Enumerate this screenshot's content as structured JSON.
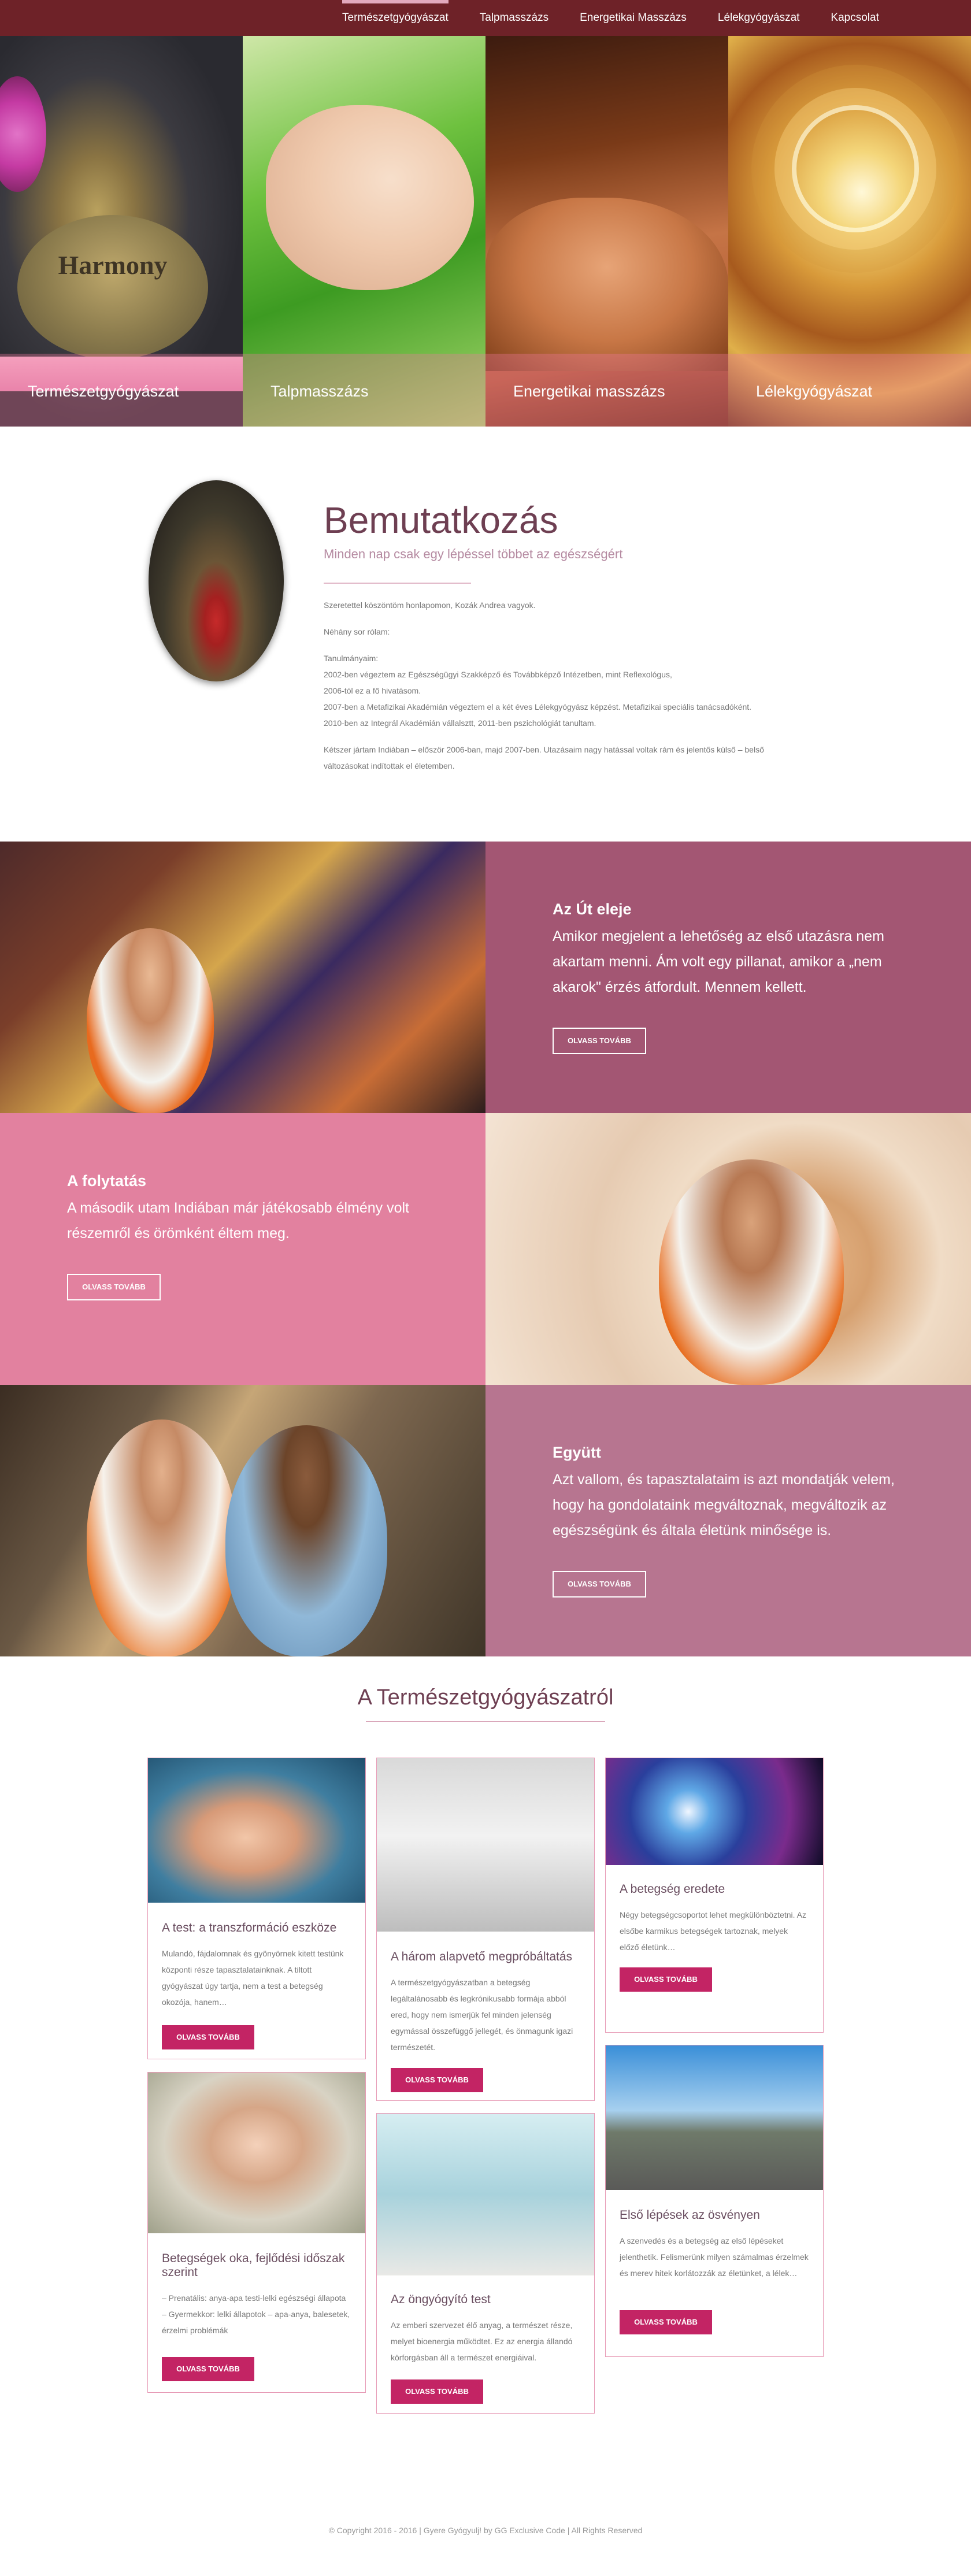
{
  "nav": {
    "items": [
      {
        "label": "Természetgyógyászat",
        "active": true
      },
      {
        "label": "Talpmasszázs",
        "active": false
      },
      {
        "label": "Energetikai Masszázs",
        "active": false
      },
      {
        "label": "Lélekgyógyászat",
        "active": false
      },
      {
        "label": "Kapcsolat",
        "active": false
      }
    ]
  },
  "hero": {
    "tiles": [
      {
        "label": "Természetgyógyászat",
        "stone_text": "Harmony"
      },
      {
        "label": "Talpmasszázs"
      },
      {
        "label": "Energetikai masszázs"
      },
      {
        "label": "Lélekgyógyászat"
      }
    ]
  },
  "intro": {
    "title": "Bemutatkozás",
    "subtitle": "Minden nap csak egy lépéssel többet az egészségért",
    "paragraphs": [
      "Szeretettel köszöntöm honlapomon, Kozák Andrea vagyok.",
      "Néhány sor rólam:"
    ],
    "studies_heading": "Tanulmányaim:",
    "studies": [
      "2002-ben végeztem az Egészségügyi Szakképző és Továbbképző Intézetben, mint Reflexológus,",
      "2006-tól ez a fő hivatásom.",
      "2007-ben a Metafizikai Akadémián végeztem el a két éves Lélekgyógyász képzést. Metafizikai speciális tanácsadóként.",
      "2010-ben az Integrál Akadémián vállalsztt, 2011-ben pszichológiát tanultam."
    ],
    "closing": "Kétszer jártam Indiában – először 2006-ban, majd 2007-ben. Utazásaim nagy hatással voltak rám és jelentős külső – belső változásokat indítottak el életemben."
  },
  "bands": [
    {
      "title": "Az Út eleje",
      "text": "Amikor megjelent a lehetőség az első utazásra nem akartam menni. Ám volt egy pillanat, amikor a „nem akarok\" érzés átfordult. Mennem kellett.",
      "button": "OLVASS TOVÁBB"
    },
    {
      "title": "A folytatás",
      "text": "A második utam Indiában már játékosabb élmény volt részemről és örömként éltem meg.",
      "button": "OLVASS TOVÁBB"
    },
    {
      "title": "Együtt",
      "text": "Azt vallom, és tapasztalataim is azt mondatják velem, hogy ha gondolataink megváltoznak, megváltozik az egészségünk és általa életünk minősége is.",
      "button": "OLVASS TOVÁBB"
    }
  ],
  "blog": {
    "heading": "A Természetgyógyászatról",
    "cards": [
      {
        "title": "A test: a transzformáció eszköze",
        "text": "Mulandó, fájdalomnak és gyönyörnek kitett testünk központi része tapasztalatainknak. A tiltott gyógyászat úgy tartja, nem a test a betegség okozója, hanem…",
        "button": "OLVASS TOVÁBB"
      },
      {
        "title": "A három alapvető megpróbáltatás",
        "text": "A természetgyógyászatban a betegség legáltalánosabb és legkrónikusabb formája abból ered, hogy nem ismerjük fel minden jelenség egymással összefüggő jellegét, és önmagunk igazi természetét.",
        "button": "OLVASS TOVÁBB"
      },
      {
        "title": "A betegség eredete",
        "text": "Négy betegségcsoportot lehet megkülönböztetni. Az elsőbe karmikus betegségek tartoznak, melyek előző életünk…",
        "button": "OLVASS TOVÁBB"
      },
      {
        "title": "Betegségek oka, fejlődési időszak szerint",
        "text": "– Prenatális: anya-apa testi-lelki egészségi állapota – Gyermekkor: lelki állapotok – apa-anya, balesetek, érzelmi problémák",
        "button": "OLVASS TOVÁBB"
      },
      {
        "title": "Az öngyógyító test",
        "text": "Az emberi szervezet élő anyag, a természet része, melyet bioenergia működtet. Ez az energia állandó körforgásban áll a természet energiáival.",
        "button": "OLVASS TOVÁBB"
      },
      {
        "title": "Első lépések az ösvényen",
        "text": "A szenvedés és a betegség az első lépéseket jelenthetik. Felismerünk milyen számalmas érzelmek és merev hitek korlátozzák az életünket, a lélek…",
        "button": "OLVASS TOVÁBB"
      }
    ]
  },
  "footer": {
    "copyright": "© Copyright 2016 - 2016   |   Gyere Gyógyulj! by GG Exclusive Code   |   All Rights Reserved"
  }
}
